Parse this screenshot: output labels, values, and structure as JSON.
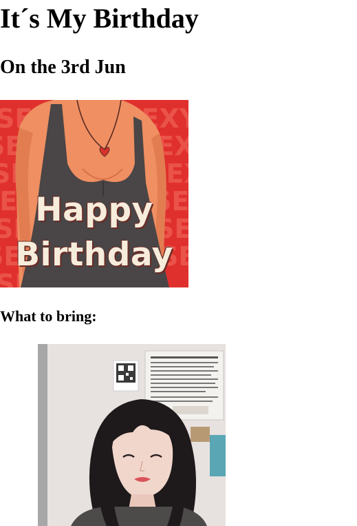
{
  "page": {
    "title": "It´s My Birthday",
    "date_heading": "On the 3rd Jun",
    "bring_heading": "What to bring:"
  },
  "card_image": {
    "line1": "Happy",
    "line2": "Birthday",
    "background_word": "SEXY",
    "colors": {
      "background": "#e0302d",
      "skin": "#ef8f62",
      "top": "#4a4546",
      "text": "#f6ecdc"
    }
  },
  "photo_image": {
    "colors": {
      "wall": "#e7e2df",
      "hair": "#1e1a1b",
      "skin": "#f1d6cc",
      "lips": "#d9545a"
    }
  }
}
